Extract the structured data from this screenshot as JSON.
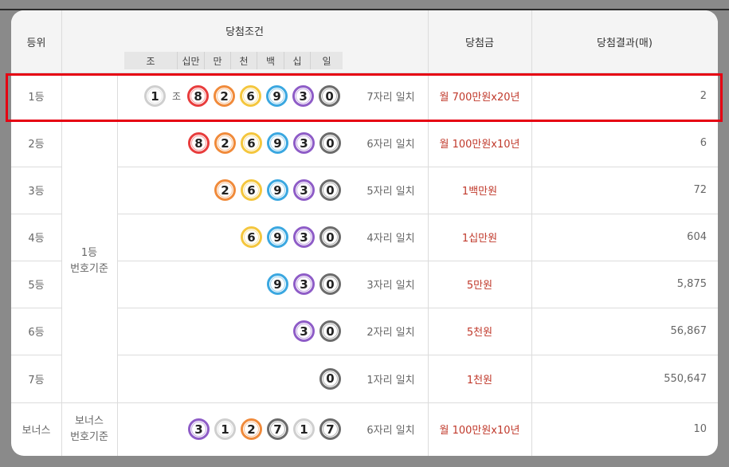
{
  "header": {
    "rank": "등위",
    "condition": "당첨조건",
    "prize": "당첨금",
    "result": "당첨결과(매)",
    "digit_labels": [
      "조",
      "십만",
      "만",
      "천",
      "백",
      "십",
      "일"
    ]
  },
  "group_labels": {
    "main": [
      "1등",
      "번호기준"
    ],
    "bonus": [
      "보너스",
      "번호기준"
    ]
  },
  "ball_colors": {
    "1": "#cfcfcf",
    "2": "#f08a3a",
    "3": "#8e5cc7",
    "6": "#f4c63d",
    "7": "#6b6b6b",
    "8": "#e83c3c",
    "9": "#3aa7e0",
    "0": "#6b6b6b"
  },
  "rows": [
    {
      "rank": "1등",
      "group": "1",
      "jo": "조",
      "balls": [
        "8",
        "2",
        "6",
        "9",
        "3",
        "0"
      ],
      "match": "7자리 일치",
      "prize": "월 700만원x20년",
      "count": "2"
    },
    {
      "rank": "2등",
      "balls": [
        "8",
        "2",
        "6",
        "9",
        "3",
        "0"
      ],
      "match": "6자리 일치",
      "prize": "월 100만원x10년",
      "count": "6"
    },
    {
      "rank": "3등",
      "balls": [
        "2",
        "6",
        "9",
        "3",
        "0"
      ],
      "match": "5자리 일치",
      "prize": "1백만원",
      "count": "72"
    },
    {
      "rank": "4등",
      "balls": [
        "6",
        "9",
        "3",
        "0"
      ],
      "match": "4자리 일치",
      "prize": "1십만원",
      "count": "604"
    },
    {
      "rank": "5등",
      "balls": [
        "9",
        "3",
        "0"
      ],
      "match": "3자리 일치",
      "prize": "5만원",
      "count": "5,875"
    },
    {
      "rank": "6등",
      "balls": [
        "3",
        "0"
      ],
      "match": "2자리 일치",
      "prize": "5천원",
      "count": "56,867"
    },
    {
      "rank": "7등",
      "balls": [
        "0"
      ],
      "match": "1자리 일치",
      "prize": "1천원",
      "count": "550,647"
    },
    {
      "rank": "보너스",
      "balls": [
        "3",
        "1",
        "2",
        "7",
        "1",
        "7"
      ],
      "match": "6자리 일치",
      "prize": "월 100만원x10년",
      "count": "10"
    }
  ]
}
